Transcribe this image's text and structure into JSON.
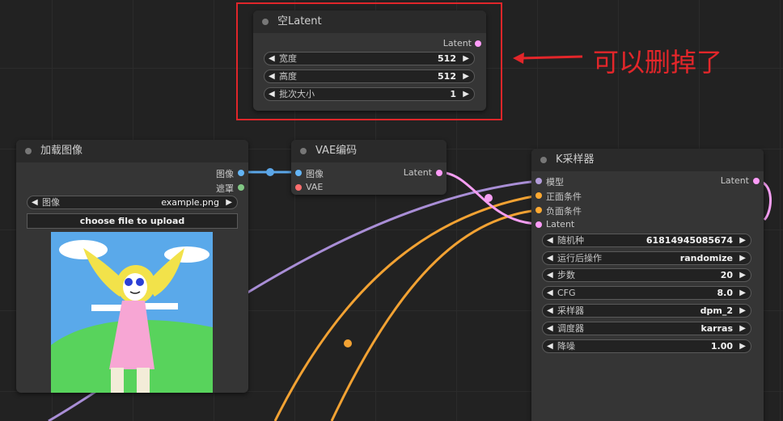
{
  "annotation": {
    "text": "可以删掉了",
    "color": "#e3262a"
  },
  "empty_latent": {
    "title": "空Latent",
    "output_label": "Latent",
    "widgets": [
      {
        "label": "宽度",
        "value": "512"
      },
      {
        "label": "高度",
        "value": "512"
      },
      {
        "label": "批次大小",
        "value": "1"
      }
    ]
  },
  "load_image": {
    "title": "加载图像",
    "outputs": [
      "图像",
      "遮罩"
    ],
    "widget": {
      "label": "图像",
      "value": "example.png"
    },
    "upload_label": "choose file to upload"
  },
  "vae_encode": {
    "title": "VAE编码",
    "inputs": [
      "图像",
      "VAE"
    ],
    "output_label": "Latent"
  },
  "ksampler": {
    "title": "K采样器",
    "inputs": [
      "模型",
      "正面条件",
      "负面条件",
      "Latent"
    ],
    "output_label": "Latent",
    "widgets": [
      {
        "label": "随机种",
        "value": "61814945085674"
      },
      {
        "label": "运行后操作",
        "value": "randomize"
      },
      {
        "label": "步数",
        "value": "20"
      },
      {
        "label": "CFG",
        "value": "8.0"
      },
      {
        "label": "采样器",
        "value": "dpm_2"
      },
      {
        "label": "调度器",
        "value": "karras"
      },
      {
        "label": "降噪",
        "value": "1.00"
      }
    ]
  },
  "colors": {
    "image_slot": "#64b5f6",
    "mask_slot": "#81c784",
    "vae_slot": "#ff6e6e",
    "latent_slot": "#ff9cf9",
    "model_slot": "#b39ddb",
    "conditioning_slot": "#ffa931",
    "link_model": "#a98ed6",
    "link_conditioning": "#f2a233",
    "link_latent": "#f59ef2",
    "link_image": "#5ba6e8"
  }
}
